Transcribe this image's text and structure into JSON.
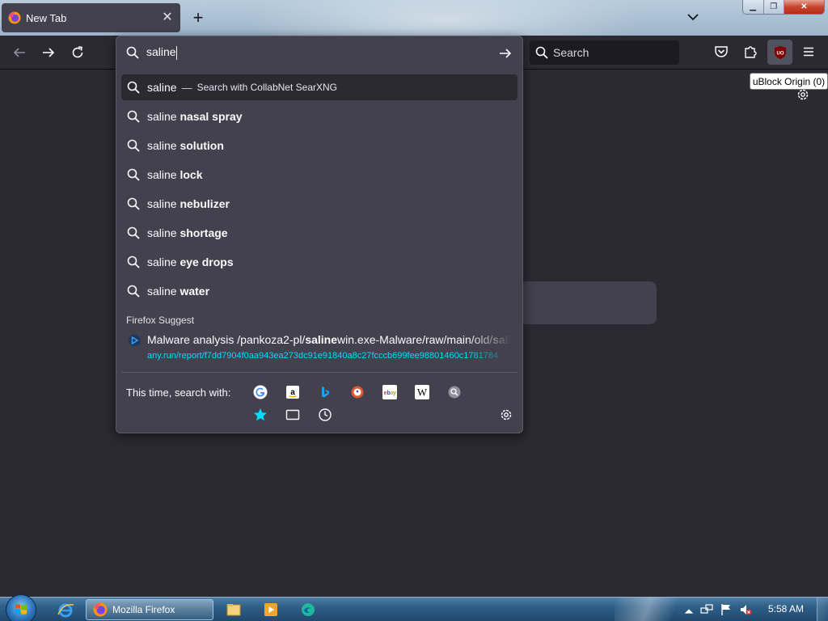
{
  "browser": {
    "tab": {
      "title": "New Tab"
    },
    "search_box": {
      "placeholder": "Search"
    },
    "extension_tooltip": "uBlock Origin (0)",
    "extension_badge": "UO"
  },
  "urlbar": {
    "value": "saline",
    "suggestions": [
      {
        "query": "saline",
        "separator": "—",
        "action": "Search with CollabNet SearXNG"
      },
      {
        "query": "saline ",
        "completion": "nasal spray"
      },
      {
        "query": "saline ",
        "completion": "solution"
      },
      {
        "query": "saline ",
        "completion": "lock"
      },
      {
        "query": "saline ",
        "completion": "nebulizer"
      },
      {
        "query": "saline ",
        "completion": "shortage"
      },
      {
        "query": "saline ",
        "completion": "eye drops"
      },
      {
        "query": "saline ",
        "completion": "water"
      }
    ],
    "firefox_suggest": {
      "label": "Firefox Suggest",
      "title_before": "Malware analysis /pankoza2-pl/",
      "title_bold1": "saline",
      "title_after": "win.exe-Malware/raw/main/old/",
      "title_bold2": "saline",
      "url": "any.run/report/f7dd7904f0aa943ea273dc91e91840a8c27fcccb699fee98801460c1781784"
    },
    "one_offs": {
      "label": "This time, search with:",
      "engines": [
        "google-icon",
        "amazon-icon",
        "bing-icon",
        "duckduckgo-icon",
        "ebay-icon",
        "wikipedia-icon",
        "searxng-icon"
      ],
      "modes": [
        "bookmarks-star-icon",
        "tabs-icon",
        "history-clock-icon"
      ]
    }
  },
  "taskbar": {
    "firefox_label": "Mozilla Firefox",
    "clock": "5:58 AM"
  },
  "colors": {
    "background": "#2b2a33",
    "panel": "#42414d",
    "url_link": "#00ddff"
  }
}
